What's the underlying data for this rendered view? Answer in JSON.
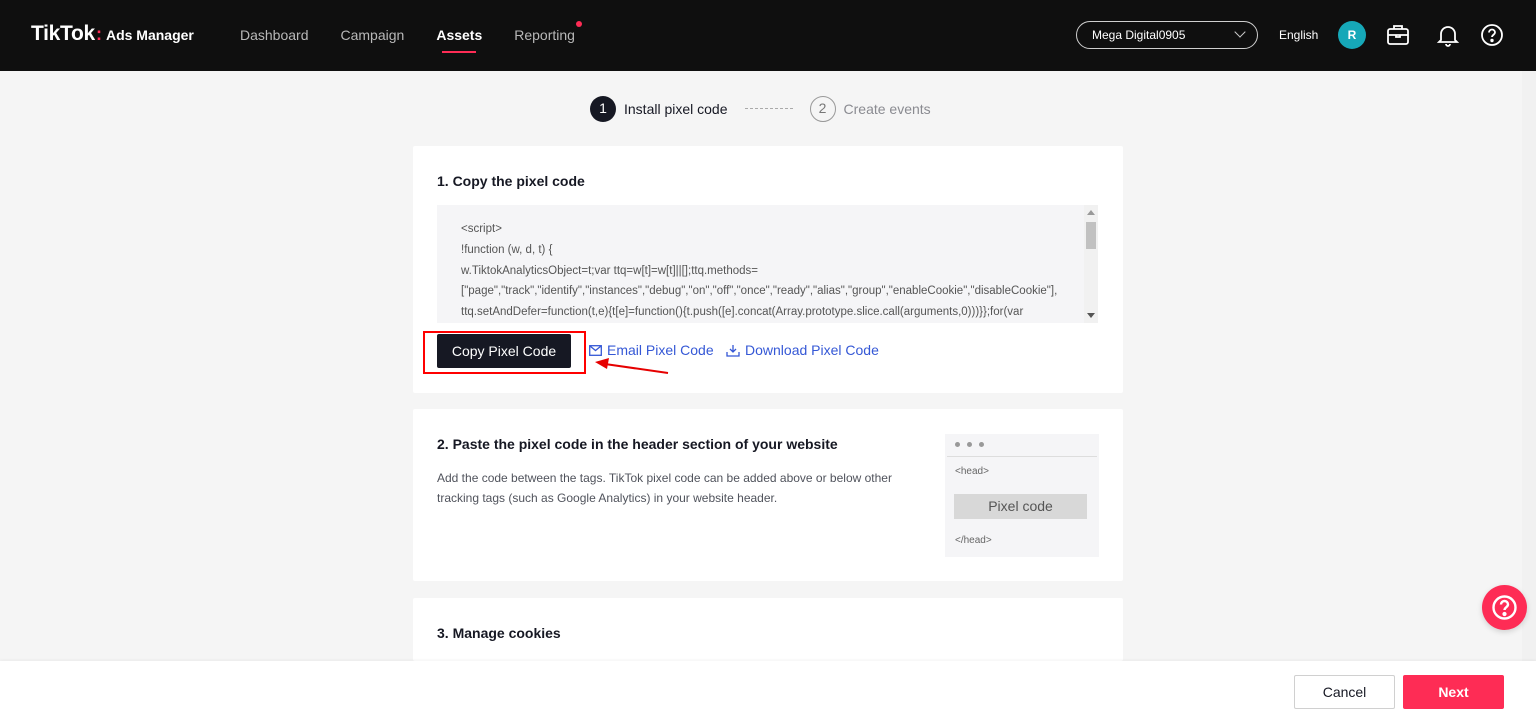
{
  "colors": {
    "accent": "#fe2c55",
    "nav_bg": "#0f0f0f",
    "link": "#3558d6",
    "highlight": "#ff0000"
  },
  "header": {
    "logo_main": "TikTok",
    "logo_dot": ":",
    "logo_sub": "Ads Manager",
    "nav": [
      {
        "label": "Dashboard"
      },
      {
        "label": "Campaign"
      },
      {
        "label": "Assets",
        "active": true
      },
      {
        "label": "Reporting",
        "badge": true
      }
    ],
    "account": "Mega Digital0905",
    "language": "English",
    "avatar_initial": "R",
    "icons": [
      "briefcase-icon",
      "bell-icon",
      "help-circle-icon"
    ]
  },
  "stepper": {
    "steps": [
      {
        "num": "1",
        "label": "Install pixel code"
      },
      {
        "num": "2",
        "label": "Create events"
      }
    ]
  },
  "section1": {
    "title": "1. Copy the pixel code",
    "code_lines": [
      "<script>",
      "!function (w, d, t) {",
      "  w.TiktokAnalyticsObject=t;var ttq=w[t]=w[t]||[];ttq.methods=",
      "[\"page\",\"track\",\"identify\",\"instances\",\"debug\",\"on\",\"off\",\"once\",\"ready\",\"alias\",\"group\",\"enableCookie\",\"disableCookie\"],",
      "ttq.setAndDefer=function(t,e){t[e]=function(){t.push([e].concat(Array.prototype.slice.call(arguments,0)))}};for(var"
    ],
    "copy_label": "Copy Pixel Code",
    "email_label": "Email Pixel Code",
    "download_label": "Download Pixel Code"
  },
  "section2": {
    "title": "2. Paste the pixel code in the header section of your website",
    "desc": "Add the code between the tags. TikTok pixel code can be added above or below other tracking tags (such as Google Analytics) in your website header.",
    "illus_open": "<head>",
    "illus_pill": "Pixel code",
    "illus_close": "</head>"
  },
  "section3": {
    "title": "3. Manage cookies"
  },
  "footer": {
    "cancel": "Cancel",
    "next": "Next"
  }
}
